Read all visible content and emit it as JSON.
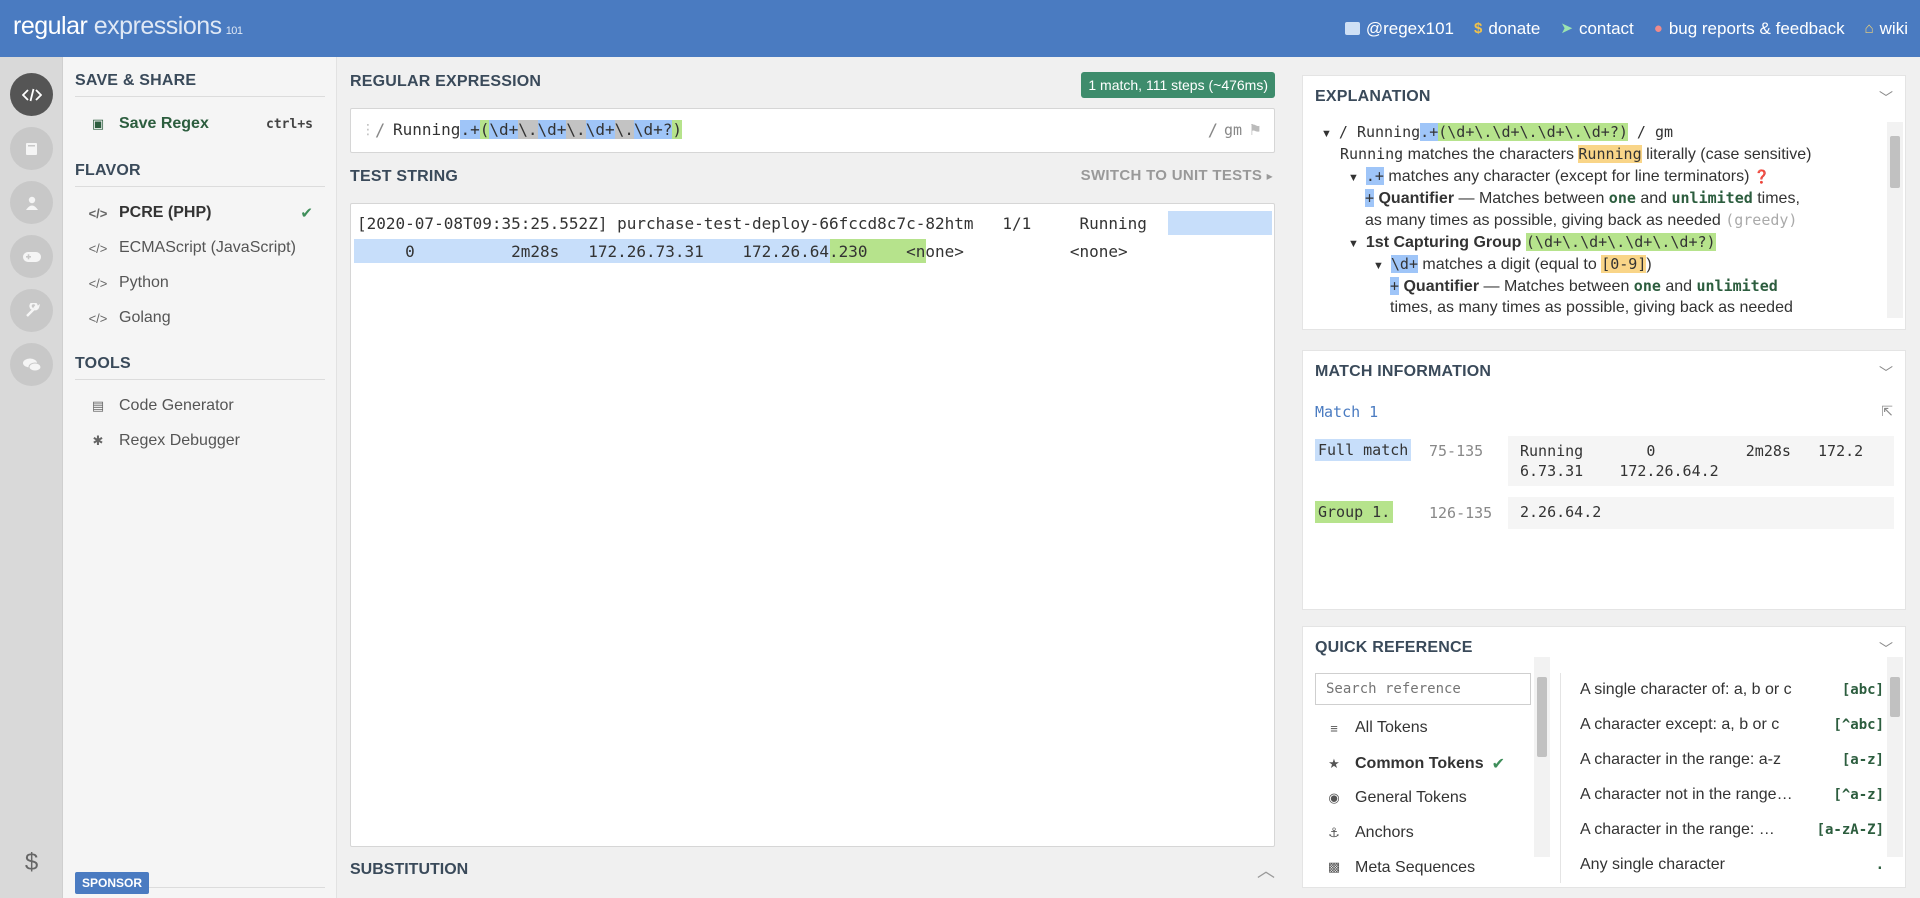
{
  "topbar": {
    "logo_main": "regular",
    "logo_rest": " expressions",
    "logo_sup": "101",
    "links": [
      {
        "icon": "twitter-icon",
        "label": "@regex101"
      },
      {
        "icon": "dollar-icon",
        "label": "donate"
      },
      {
        "icon": "paper-plane-icon",
        "label": "contact"
      },
      {
        "icon": "github-icon",
        "label": "bug reports & feedback"
      },
      {
        "icon": "bank-icon",
        "label": "wiki"
      }
    ]
  },
  "sidebar": {
    "save_share_title": "SAVE & SHARE",
    "save_label": "Save Regex",
    "save_shortcut": "ctrl+s",
    "flavor_title": "FLAVOR",
    "flavors": [
      "PCRE (PHP)",
      "ECMAScript (JavaScript)",
      "Python",
      "Golang"
    ],
    "selected_flavor": "PCRE (PHP)",
    "tools_title": "TOOLS",
    "tools": [
      "Code Generator",
      "Regex Debugger"
    ],
    "sponsor": "SPONSOR"
  },
  "center": {
    "regex_title": "REGULAR EXPRESSION",
    "match_badge": "1 match, 111 steps (~476ms)",
    "delim_open": "/",
    "delim_close": "/",
    "flags": "gm",
    "regex_parts": {
      "literal": "Running",
      "dotplus": ".+",
      "paren_open": "(",
      "d1": "\\d+",
      "e1": "\\.",
      "d2": "\\d+",
      "e2": "\\.",
      "d3": "\\d+",
      "e3": "\\.",
      "d4": "\\d+?",
      "paren_close": ")"
    },
    "test_title": "TEST STRING",
    "switch_unit": "SWITCH TO UNIT TESTS",
    "test_line1": "[2020-07-08T09:35:25.552Z] purchase-test-deploy-66fccd8c7c-82htm   1/1     Running",
    "test_line2": "     0          2m28s   172.26.73.31    172.26.64.230    <none>           <none>",
    "substitution_title": "SUBSTITUTION"
  },
  "explanation": {
    "title": "EXPLANATION",
    "l1_prefix": "/ Running",
    "l1_dot": ".+",
    "l1_group": "(\\d+\\.\\d+\\.\\d+\\.\\d+?)",
    "l1_suffix": " / gm",
    "l2_a": "Running",
    "l2_b": " matches the characters ",
    "l2_c": "Running",
    "l2_d": " literally (case sensitive)",
    "l3_tok": ".+",
    "l3_text": " matches any character (except for line terminators)",
    "l4_tok": "+",
    "l4_q": "Quantifier",
    "l4_text": " — Matches between ",
    "l4_one": "one",
    "l4_and": " and ",
    "l4_unl": "unlimited",
    "l4_times": " times,",
    "l5_text": "as many times as possible, giving back as needed ",
    "l5_greedy": "(greedy)",
    "l6_title": "1st Capturing Group",
    "l6_group": "(\\d+\\.\\d+\\.\\d+\\.\\d+?)",
    "l7_tok": "\\d+",
    "l7_text": " matches a digit (equal to ",
    "l7_range": "[0-9]",
    "l7_close": ")",
    "l8_tok": "+",
    "l8_q": "Quantifier",
    "l8_text": " — Matches between ",
    "l8_one": "one",
    "l8_and": " and ",
    "l8_unl": "unlimited",
    "l9_text": "times, as many times as possible, giving back as needed"
  },
  "match_info": {
    "title": "MATCH INFORMATION",
    "match_label": "Match 1",
    "rows": [
      {
        "label": "Full match",
        "range": "75-135",
        "value_line1": "Running       0          2m28s   172.2",
        "value_line2": "6.73.31    172.26.64.2"
      },
      {
        "label": "Group 1.",
        "range": "126-135",
        "value_line1": "2.26.64.2",
        "value_line2": ""
      }
    ]
  },
  "quick_reference": {
    "title": "QUICK REFERENCE",
    "search_placeholder": "Search reference",
    "categories": [
      {
        "icon": "database-icon",
        "label": "All Tokens"
      },
      {
        "icon": "star-icon",
        "label": "Common Tokens"
      },
      {
        "icon": "circle-dot-icon",
        "label": "General Tokens"
      },
      {
        "icon": "anchor-icon",
        "label": "Anchors"
      },
      {
        "icon": "cube-icon",
        "label": "Meta Sequences"
      }
    ],
    "selected_category": "Common Tokens",
    "refs": [
      {
        "desc": "A single character of: a, b or c",
        "token": "[abc]"
      },
      {
        "desc": "A character except: a, b or c",
        "token": "[^abc]"
      },
      {
        "desc": "A character in the range: a-z",
        "token": "[a-z]"
      },
      {
        "desc": "A character not in the range…",
        "token": "[^a-z]"
      },
      {
        "desc": "A character in the range: …",
        "token": "[a-zA-Z]"
      },
      {
        "desc": "Any single character",
        "token": "."
      }
    ]
  },
  "colors": {
    "topbar": "#4a7bc1",
    "match_badge": "#3e8c6c",
    "match_highlight": "#c7defa",
    "group_highlight": "#b6e38c",
    "token_blue": "#9fc5f8",
    "token_yellow": "#f9d588",
    "accent_green": "#2c5d3e"
  }
}
